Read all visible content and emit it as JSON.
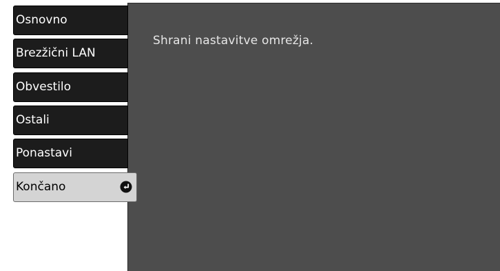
{
  "menu": {
    "items": [
      {
        "label": "Osnovno"
      },
      {
        "label": "Brezžični LAN"
      },
      {
        "label": "Obvestilo"
      },
      {
        "label": "Ostali"
      },
      {
        "label": "Ponastavi"
      },
      {
        "label": "Končano",
        "selected": true
      }
    ]
  },
  "content": {
    "message": "Shrani nastavitve omrežja."
  },
  "colors": {
    "panel_background": "#4d4d4d",
    "menu_item_background": "#1c1c1c",
    "selected_item_background": "#d4d4d4"
  },
  "icons": {
    "selected_item_icon": "enter-icon"
  }
}
